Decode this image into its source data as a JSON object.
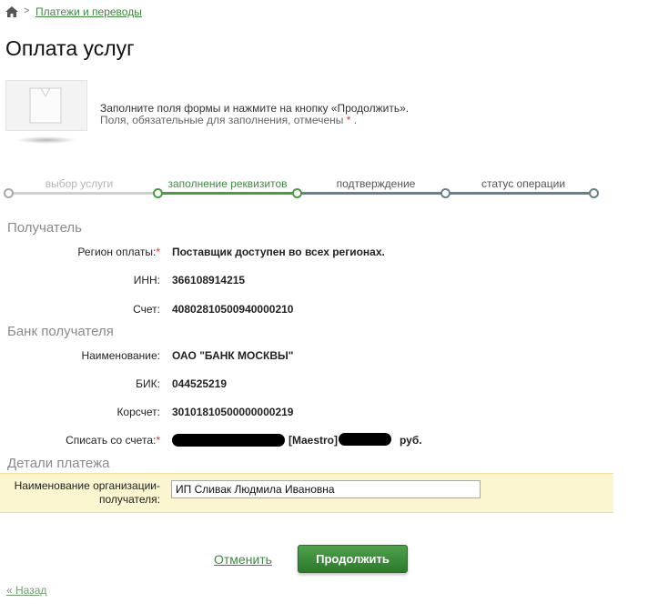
{
  "breadcrumb": {
    "separator": ">",
    "link": "Платежи и переводы"
  },
  "page_title": "Оплата услуг",
  "info": {
    "line1": "Заполните поля формы и нажмите на кнопку «Продолжить».",
    "line2_prefix": "Поля, обязательные для заполнения, отмечены",
    "required_mark": "*",
    "line2_suffix": "."
  },
  "steps": [
    {
      "label": "выбор услуги",
      "state": "done"
    },
    {
      "label": "заполнение реквизитов",
      "state": "active"
    },
    {
      "label": "подтверждение",
      "state": "todo"
    },
    {
      "label": "статус операции",
      "state": "todo"
    }
  ],
  "recipient": {
    "title": "Получатель",
    "region_label": "Регион оплаты:",
    "region_value": "Поставщик доступен во всех регионах.",
    "inn_label": "ИНН:",
    "inn_value": "366108914215",
    "account_label": "Счет:",
    "account_value": "40802810500940000210"
  },
  "bank": {
    "title": "Банк получателя",
    "name_label": "Наименование:",
    "name_value": "ОАО \"БАНК МОСКВЫ\"",
    "bik_label": "БИК:",
    "bik_value": "044525219",
    "corr_label": "Корсчет:",
    "corr_value": "30101810500000000219",
    "debit_label": "Списать со счета:",
    "debit_card_type": "[Maestro]",
    "debit_currency": "руб."
  },
  "details": {
    "title": "Детали платежа",
    "org_label_line1": "Наименование организации-",
    "org_label_line2": "получателя:",
    "org_value": "ИП Сливак Людмила Ивановна"
  },
  "actions": {
    "cancel": "Отменить",
    "continue": "Продолжить",
    "back": "« Назад"
  },
  "colors": {
    "accent": "#3f8a3f",
    "required": "#e03030",
    "highlight": "#fbf5d0"
  }
}
